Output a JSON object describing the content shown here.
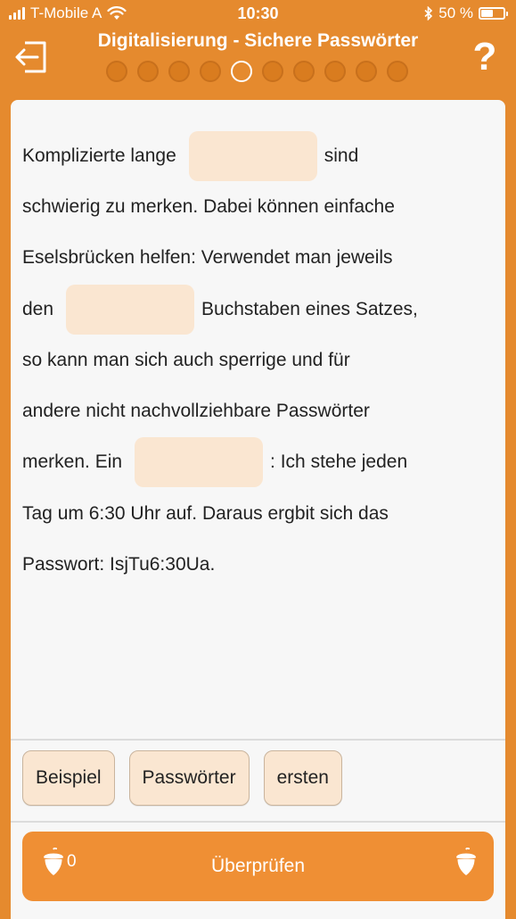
{
  "status_bar": {
    "carrier": "T-Mobile A",
    "time": "10:30",
    "battery_percent": "50 %",
    "battery_level": 0.5
  },
  "header": {
    "title": "Digitalisierung - Sichere Passwörter",
    "progress_total": 10,
    "progress_current": 5,
    "help_label": "?"
  },
  "exercise": {
    "lines": [
      {
        "before": "Komplizierte lange",
        "gap": true,
        "after": "sind"
      },
      {
        "before": "schwierig zu merken. Dabei können einfache",
        "gap": false,
        "after": ""
      },
      {
        "before": "Eselsbrücken helfen: Verwendet man jeweils",
        "gap": false,
        "after": ""
      },
      {
        "before": "den",
        "gap": true,
        "after": "Buchstaben eines Satzes,"
      },
      {
        "before": "so kann man sich auch sperrige und für",
        "gap": false,
        "after": ""
      },
      {
        "before": "andere nicht nachvollziehbare Passwörter",
        "gap": false,
        "after": ""
      },
      {
        "before": "merken. Ein",
        "gap": true,
        "after": ": Ich stehe jeden"
      },
      {
        "before": "Tag um 6:30 Uhr auf. Daraus ergbit sich das",
        "gap": false,
        "after": ""
      },
      {
        "before": "Passwort: IsjTu6:30Ua.",
        "gap": false,
        "after": ""
      }
    ]
  },
  "word_bank": [
    "Beispiel",
    "Passwörter",
    "ersten"
  ],
  "check_button": {
    "label": "Überprüfen",
    "acorn_count": "0"
  },
  "colors": {
    "background": "#e58a2e",
    "button": "#ef8f34",
    "gap_fill": "#fae6d1"
  }
}
